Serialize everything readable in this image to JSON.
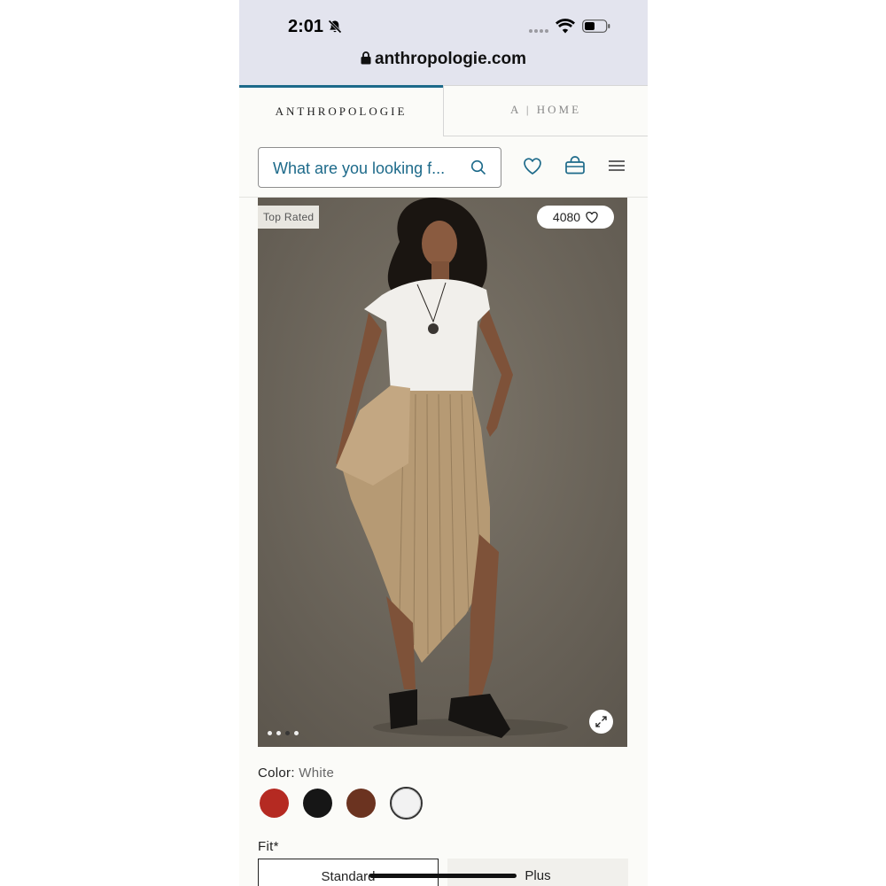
{
  "status_bar": {
    "time": "2:01"
  },
  "browser": {
    "url": "anthropologie.com"
  },
  "brand_tabs": [
    {
      "label": "ANTHROPOLOGIE",
      "active": true
    },
    {
      "label": "A | HOME",
      "active": false
    }
  ],
  "search": {
    "placeholder": "What are you looking f..."
  },
  "header_icons": [
    "heart-icon",
    "shopping-bag-icon",
    "menu-icon"
  ],
  "product_image": {
    "badge": "Top Rated",
    "likes": "4080",
    "image_count": 4,
    "active_image": 3
  },
  "color": {
    "label": "Color:",
    "selected": "White",
    "swatches": [
      {
        "name": "red",
        "hex": "#b52a22"
      },
      {
        "name": "black",
        "hex": "#161616"
      },
      {
        "name": "brown",
        "hex": "#6b3320"
      },
      {
        "name": "white",
        "hex": "#f2f2f2"
      }
    ]
  },
  "fit": {
    "label": "Fit*",
    "options": [
      {
        "label": "Standard",
        "selected": true
      },
      {
        "label": "Plus",
        "selected": false
      }
    ]
  },
  "colors": {
    "accent": "#1d6a8a",
    "background": "#fbfbf8",
    "url_bar": "#e3e4ee"
  }
}
